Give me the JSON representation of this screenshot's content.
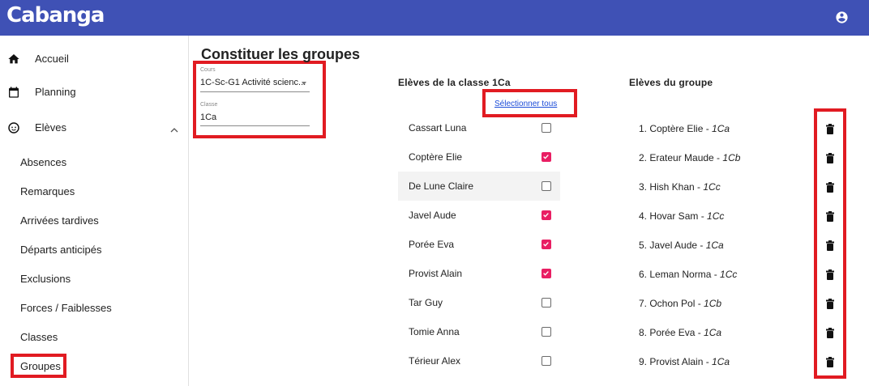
{
  "app": {
    "logo": "Cabanga"
  },
  "sidebar": {
    "items": [
      {
        "label": "Accueil",
        "icon": "home-icon"
      },
      {
        "label": "Planning",
        "icon": "calendar-icon"
      },
      {
        "label": "Elèves",
        "icon": "face-icon"
      }
    ],
    "sub_items": [
      "Absences",
      "Remarques",
      "Arrivées tardives",
      "Départs anticipés",
      "Exclusions",
      "Forces / Faiblesses",
      "Classes",
      "Groupes"
    ]
  },
  "page": {
    "title": "Constituer les groupes",
    "cours": {
      "label": "Cours",
      "value": "1C-Sc-G1 Activité scienc..."
    },
    "classe": {
      "label": "Classe",
      "value": "1Ca"
    }
  },
  "students": {
    "heading": "Elèves de la classe 1Ca",
    "select_all": "Sélectionner tous",
    "rows": [
      {
        "name": "Cassart Luna",
        "checked": false
      },
      {
        "name": "Coptère Elie",
        "checked": true
      },
      {
        "name": "De Lune Claire",
        "checked": false
      },
      {
        "name": "Javel Aude",
        "checked": true
      },
      {
        "name": "Porée Eva",
        "checked": true
      },
      {
        "name": "Provist Alain",
        "checked": true
      },
      {
        "name": "Tar Guy",
        "checked": false
      },
      {
        "name": "Tomie Anna",
        "checked": false
      },
      {
        "name": "Térieur Alex",
        "checked": false
      }
    ]
  },
  "group": {
    "heading": "Elèves du groupe",
    "members": [
      {
        "name": "1. Coptère Elie - ",
        "class": "1Ca"
      },
      {
        "name": "2. Erateur Maude - ",
        "class": "1Cb"
      },
      {
        "name": "3. Hish Khan - ",
        "class": "1Cc"
      },
      {
        "name": "4. Hovar Sam - ",
        "class": "1Cc"
      },
      {
        "name": "5. Javel Aude - ",
        "class": "1Ca"
      },
      {
        "name": "6. Leman Norma - ",
        "class": "1Cc"
      },
      {
        "name": "7. Ochon Pol - ",
        "class": "1Cb"
      },
      {
        "name": "8. Porée Eva - ",
        "class": "1Ca"
      },
      {
        "name": "9. Provist Alain - ",
        "class": "1Ca"
      }
    ]
  },
  "colors": {
    "topbar": "#3f51b5",
    "accent": "#e91e63",
    "highlight": "#e11b22",
    "link": "#1a4bd8"
  }
}
